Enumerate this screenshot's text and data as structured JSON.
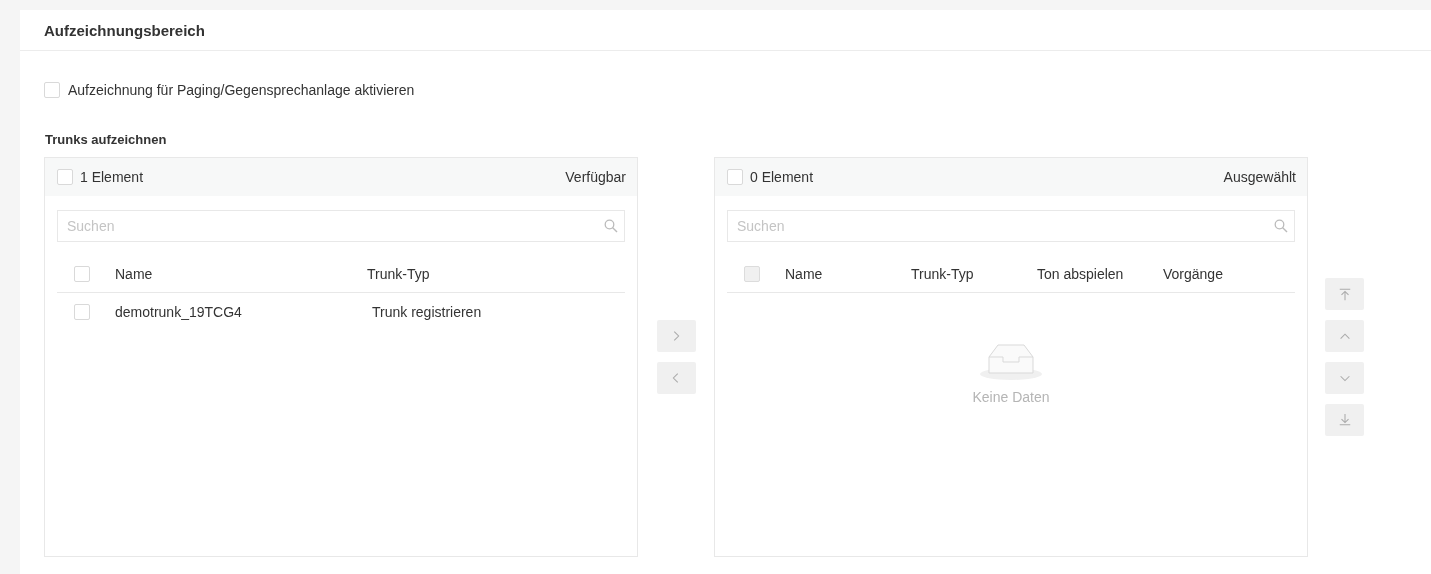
{
  "section": {
    "title": "Aufzeichnungsbereich"
  },
  "paging_recording": {
    "label": "Aufzeichnung für Paging/Gegensprechanlage aktivieren",
    "checked": false
  },
  "trunks": {
    "label": "Trunks aufzeichnen",
    "available": {
      "count": "1 Element",
      "title": "Verfügbar",
      "all_checked": false,
      "search": {
        "placeholder": "Suchen"
      },
      "header_checkbox_disabled": false,
      "columns": [
        "Name",
        "Trunk-Typ"
      ],
      "rows": [
        {
          "cells": [
            "demotrunk_19TCG4",
            "Trunk registrieren"
          ],
          "checked": false
        }
      ]
    },
    "transfer_buttons": [
      {
        "kind": "right",
        "disabled": true
      },
      {
        "kind": "left",
        "disabled": true
      }
    ],
    "selected": {
      "count": "0 Element",
      "title": "Ausgewählt",
      "all_checked": false,
      "search": {
        "placeholder": "Suchen"
      },
      "header_checkbox_disabled": true,
      "columns": [
        "Name",
        "Trunk-Typ",
        "Ton abspielen",
        "Vorgänge"
      ],
      "empty_text": "Keine Daten"
    },
    "order_buttons": [
      {
        "kind": "top",
        "disabled": true
      },
      {
        "kind": "up",
        "disabled": true
      },
      {
        "kind": "down",
        "disabled": true
      },
      {
        "kind": "bottom",
        "disabled": true
      }
    ]
  }
}
